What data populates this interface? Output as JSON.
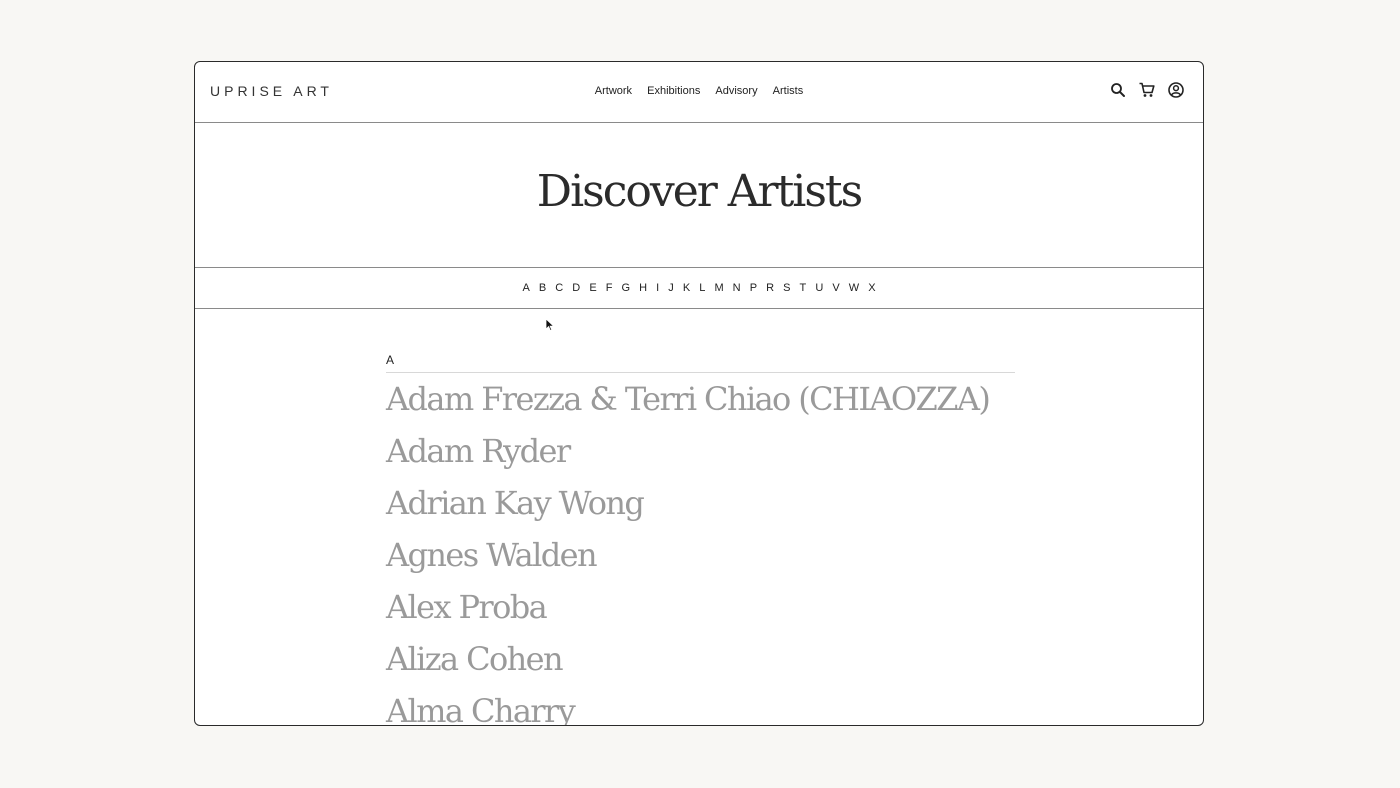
{
  "header": {
    "logo": "UPRISE ART",
    "nav": [
      "Artwork",
      "Exhibitions",
      "Advisory",
      "Artists"
    ],
    "icons": [
      "search-icon",
      "cart-icon",
      "account-icon"
    ]
  },
  "hero": {
    "title": "Discover Artists"
  },
  "alphabet": [
    "A",
    "B",
    "C",
    "D",
    "E",
    "F",
    "G",
    "H",
    "I",
    "J",
    "K",
    "L",
    "M",
    "N",
    "P",
    "R",
    "S",
    "T",
    "U",
    "V",
    "W",
    "X"
  ],
  "section": {
    "letter": "A",
    "artists": [
      "Adam Frezza & Terri Chiao (CHIAOZZA)",
      "Adam Ryder",
      "Adrian Kay Wong",
      "Agnes Walden",
      "Alex Proba",
      "Aliza Cohen",
      "Alma Charry"
    ]
  },
  "colors": {
    "background": "#f8f7f4",
    "artist_name": "#9a9a9a",
    "title": "#2b2b2b"
  }
}
